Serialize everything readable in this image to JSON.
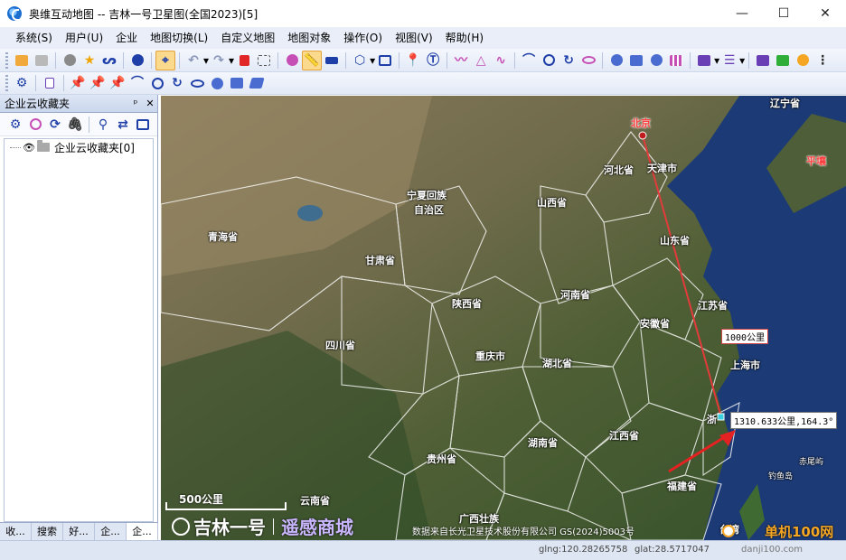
{
  "window": {
    "title": "奥维互动地图 -- 吉林一号卫星图(全国2023)[5]",
    "minimize": "—",
    "maximize": "☐",
    "close": "✕"
  },
  "menus": [
    "系统(S)",
    "用户(U)",
    "企业",
    "地图切换(L)",
    "自定义地图",
    "地图对象",
    "操作(O)",
    "视图(V)",
    "帮助(H)"
  ],
  "left_panel": {
    "title": "企业云收藏夹",
    "pin_label": "ᵖ",
    "close_label": "✕",
    "tree": [
      {
        "label": "企业云收藏夹[0]"
      }
    ],
    "tabs": [
      "收...",
      "搜索",
      "好...",
      "企...",
      "企..."
    ]
  },
  "map": {
    "provinces": [
      {
        "name": "北京",
        "style": "red"
      },
      {
        "name": "天津市"
      },
      {
        "name": "河北省"
      },
      {
        "name": "山东省"
      },
      {
        "name": "山西省"
      },
      {
        "name": "宁夏回族"
      },
      {
        "name": "自治区"
      },
      {
        "name": "青海省"
      },
      {
        "name": "甘肃省"
      },
      {
        "name": "陕西省"
      },
      {
        "name": "河南省"
      },
      {
        "name": "江苏省"
      },
      {
        "name": "安徽省"
      },
      {
        "name": "上海市"
      },
      {
        "name": "四川省"
      },
      {
        "name": "重庆市"
      },
      {
        "name": "湖北省"
      },
      {
        "name": "浙"
      },
      {
        "name": "湖南省"
      },
      {
        "name": "江西省"
      },
      {
        "name": "贵州省"
      },
      {
        "name": "福建省"
      },
      {
        "name": "云南省"
      },
      {
        "name": "广西壮族"
      },
      {
        "name": "辽宁省"
      },
      {
        "name": "平壤",
        "style": "red"
      },
      {
        "name": "赤尾屿"
      },
      {
        "name": "钓鱼岛"
      },
      {
        "name": "台湾"
      }
    ],
    "measure_1000": "1000公里",
    "measure_result": "1310.633公里,164.3°",
    "scale_label": "500公里",
    "brand_logo": "吉林一号",
    "brand_store": "遥感商城",
    "copyright": "数据来自长光卫星技术股份有限公司 GS(2024)5003号",
    "watermark": "单机100网",
    "watermark_url": "danji100.com"
  },
  "status": {
    "lng": "glng:120.28265758",
    "lat": "glat:28.5717047"
  },
  "colors": {
    "accent": "#e5a13a",
    "route": "#e23b3b",
    "ocean": "#1c3a75"
  }
}
